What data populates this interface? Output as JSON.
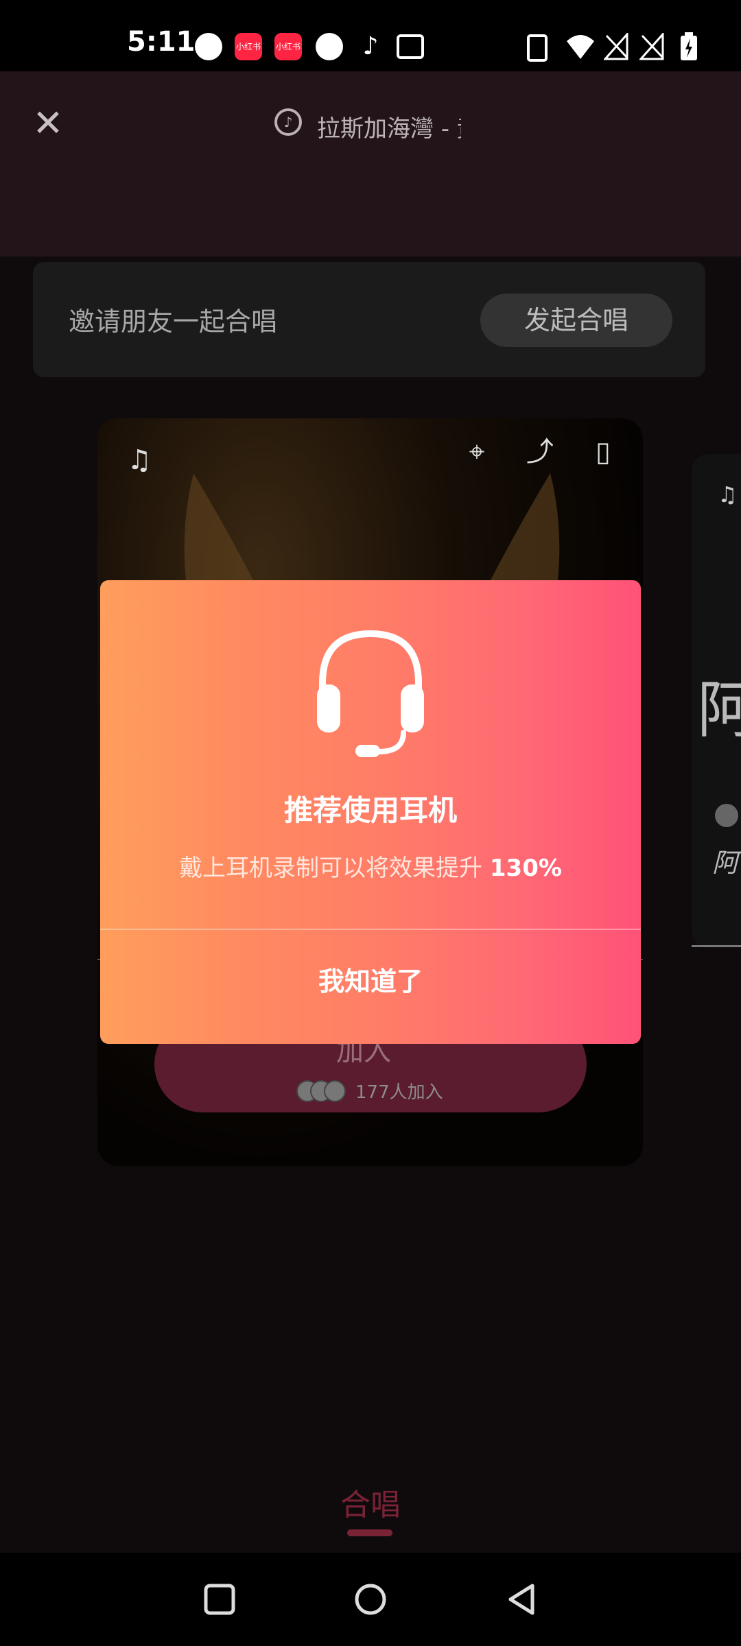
{
  "status_bar": {
    "time": "5:11",
    "notification_icons": [
      "p-icon",
      "xiaohongshu-icon",
      "xiaohongshu-icon",
      "facebook-icon",
      "tiktok-icon",
      "wallet-icon"
    ],
    "xhs_label": "小红书",
    "system_icons": [
      "vibrate-icon",
      "wifi-icon",
      "no-signal-icon",
      "no-signal-icon",
      "battery-charging-icon"
    ]
  },
  "header": {
    "song_title": "拉斯加海灣 - 黃",
    "close_icon": "close-icon",
    "music_icon": "music-disc-icon"
  },
  "invite": {
    "text": "邀请朋友一起合唱",
    "button": "发起合唱"
  },
  "card": {
    "join_label": "加入",
    "joined_count": "177人加入"
  },
  "dialog": {
    "title": "推荐使用耳机",
    "subtitle": "戴上耳机录制可以将效果提升",
    "percent": "130%",
    "confirm": "我知道了"
  },
  "right_card": {
    "char": "阿",
    "artist_short": "阿"
  },
  "bottom_tab": {
    "label": "合唱"
  },
  "colors": {
    "accent": "#ff5277",
    "gradient_start": "#ff9e5c",
    "tab_active": "#7a2236"
  }
}
